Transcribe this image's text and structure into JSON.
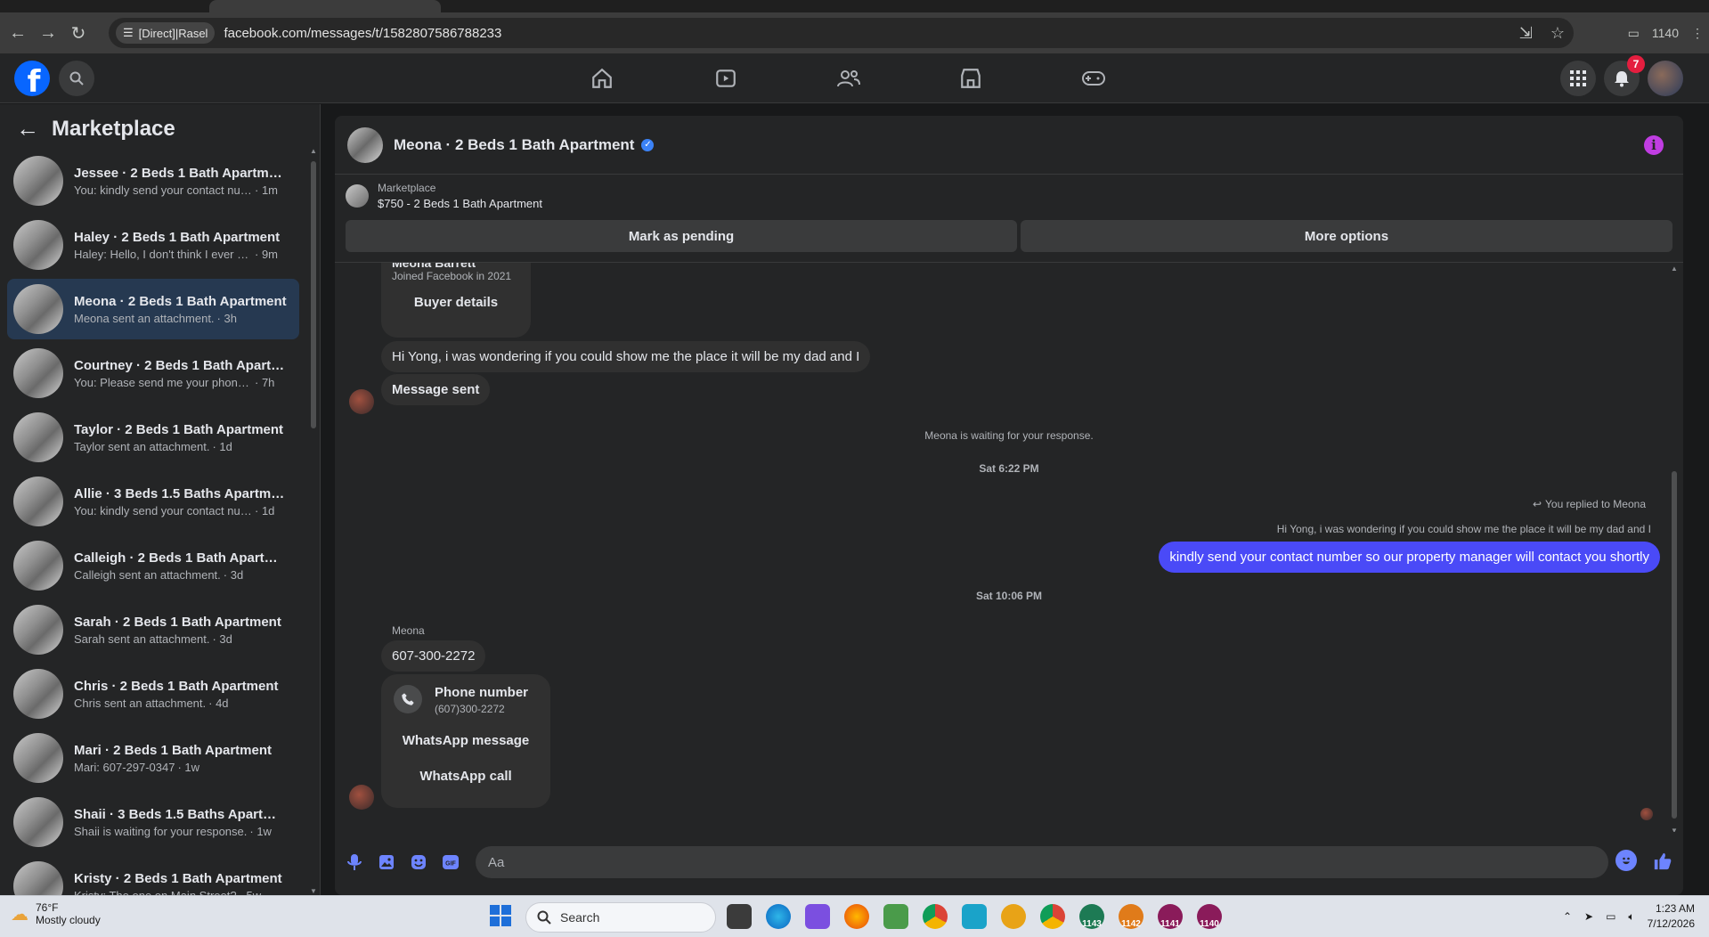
{
  "browser": {
    "site_chip": "[Direct]|Rasel",
    "url": "facebook.com/messages/t/1582807586788233",
    "profile_label": "1140"
  },
  "header": {
    "notifications_count": "7"
  },
  "sidebar": {
    "title": "Marketplace",
    "conversations": [
      {
        "name": "Jessee · 2 Beds 1 Bath Apartment",
        "preview": "You: kindly send your contact num...",
        "time": "· 1m"
      },
      {
        "name": "Haley · 2 Beds 1 Bath Apartment",
        "preview": "Haley: Hello, I don't think I ever go...",
        "time": "· 9m"
      },
      {
        "name": "Meona · 2 Beds 1 Bath Apartment",
        "preview": "Meona sent an attachment.",
        "time": "· 3h"
      },
      {
        "name": "Courtney · 2 Beds 1 Bath Apartm...",
        "preview": "You: Please send me your phone nu...",
        "time": "· 7h"
      },
      {
        "name": "Taylor · 2 Beds 1 Bath Apartment",
        "preview": "Taylor sent an attachment.",
        "time": "· 1d"
      },
      {
        "name": "Allie · 3 Beds 1.5 Baths Apartment",
        "preview": "You: kindly send your contact num...",
        "time": "· 1d"
      },
      {
        "name": "Calleigh · 2 Beds 1 Bath Apartme...",
        "preview": "Calleigh sent an attachment.",
        "time": "· 3d"
      },
      {
        "name": "Sarah · 2 Beds 1 Bath Apartment",
        "preview": "Sarah sent an attachment.",
        "time": "· 3d"
      },
      {
        "name": "Chris · 2 Beds 1 Bath Apartment",
        "preview": "Chris sent an attachment.",
        "time": "· 4d"
      },
      {
        "name": "Mari · 2 Beds 1 Bath Apartment",
        "preview": "Mari: 607-297-0347",
        "time": "· 1w"
      },
      {
        "name": "Shaii · 3 Beds 1.5 Baths Apartment",
        "preview": "Shaii is waiting for your response.",
        "time": "· 1w"
      },
      {
        "name": "Kristy · 2 Beds 1 Bath Apartment",
        "preview": "Kristy: The one on Main Street?",
        "time": "· 5w"
      }
    ]
  },
  "chat": {
    "title": "Meona · 2 Beds 1 Bath Apartment",
    "listing_source": "Marketplace",
    "listing_title": "$750 - 2 Beds 1 Bath Apartment",
    "mark_pending": "Mark as pending",
    "more_options": "More options",
    "profile_name_partial": "Meona Barrett",
    "joined": "Joined Facebook in 2021",
    "buyer_details": "Buyer details",
    "msg_question": "Hi Yong, i was wondering if you could show me the place it will be my dad and I",
    "msg_sent": "Message sent",
    "waiting": "Meona is waiting for your response.",
    "time1": "Sat 6:22 PM",
    "replied_to": "You replied to Meona",
    "quoted": "Hi Yong, i was wondering if you could show me the place it will be my dad and I",
    "my_reply": "kindly send your contact number so our property manager will contact you shortly",
    "time2": "Sat 10:06 PM",
    "sender": "Meona",
    "phone_msg": "607-300-2272",
    "phone_card_title": "Phone number",
    "phone_card_number": "(607)300-2272",
    "whatsapp_message": "WhatsApp message",
    "whatsapp_call": "WhatsApp call",
    "input_placeholder": "Aa",
    "accent": "#4a4af7"
  },
  "taskbar": {
    "temp": "76°F",
    "weather": "Mostly cloudy",
    "search": "Search",
    "time": "1:23 AM",
    "date": "7/12/2026",
    "app_badges": [
      "1143",
      "1142",
      "1141",
      "1140"
    ]
  }
}
